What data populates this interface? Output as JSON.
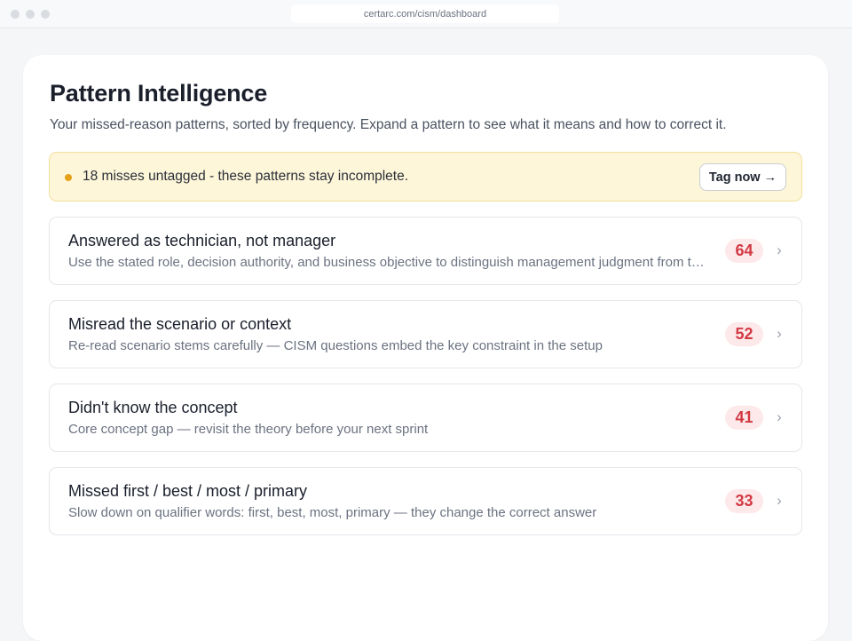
{
  "browser": {
    "url": "certarc.com/cism/dashboard"
  },
  "page": {
    "title": "Pattern Intelligence",
    "subtitle": "Your missed-reason patterns, sorted by frequency. Expand a pattern to see what it means and how to correct it."
  },
  "banner": {
    "text": "18 misses untagged - these patterns stay incomplete.",
    "button_label": "Tag now →",
    "dot_color": "#e6a11c"
  },
  "patterns": [
    {
      "title": "Answered as technician, not manager",
      "description": "Use the stated role, decision authority, and business objective to distinguish management judgment from technical execution",
      "count": "64"
    },
    {
      "title": "Misread the scenario or context",
      "description": "Re-read scenario stems carefully — CISM questions embed the key constraint in the setup",
      "count": "52"
    },
    {
      "title": "Didn't know the concept",
      "description": "Core concept gap — revisit the theory before your next sprint",
      "count": "41"
    },
    {
      "title": "Missed first / best / most / primary",
      "description": "Slow down on qualifier words: first, best, most, primary — they change the correct answer",
      "count": "33"
    }
  ],
  "icons": {
    "chevron": "›",
    "chevron_name": "chevron-right-icon"
  },
  "colors": {
    "badge_text": "#d23a43",
    "badge_bg": "#fde9ea",
    "banner_bg": "#fef6d8"
  }
}
